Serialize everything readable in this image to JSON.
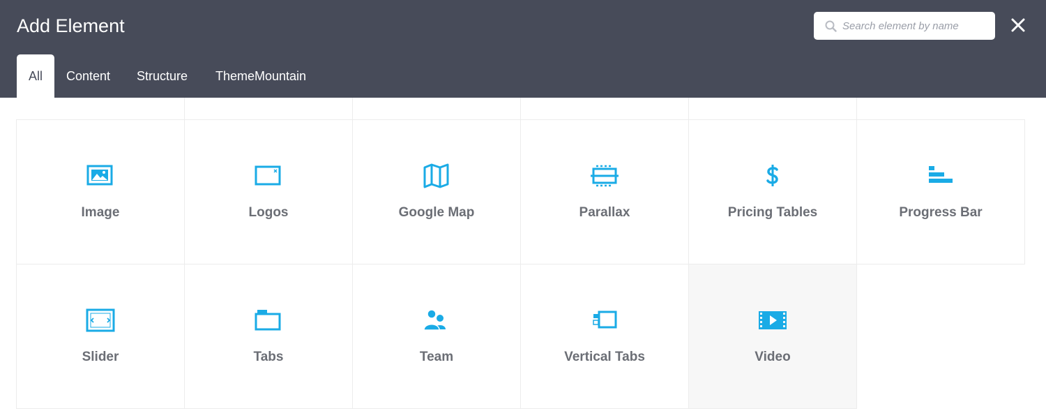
{
  "header": {
    "title": "Add Element",
    "search_placeholder": "Search element by name",
    "search_value": ""
  },
  "tabs": [
    {
      "label": "All",
      "active": true
    },
    {
      "label": "Content",
      "active": false
    },
    {
      "label": "Structure",
      "active": false
    },
    {
      "label": "ThemeMountain",
      "active": false
    }
  ],
  "elements": [
    {
      "label": "Image",
      "icon": "image-icon"
    },
    {
      "label": "Logos",
      "icon": "logos-icon"
    },
    {
      "label": "Google Map",
      "icon": "map-icon"
    },
    {
      "label": "Parallax",
      "icon": "parallax-icon"
    },
    {
      "label": "Pricing Tables",
      "icon": "dollar-icon"
    },
    {
      "label": "Progress Bar",
      "icon": "progress-bar-icon"
    },
    {
      "label": "Slider",
      "icon": "slider-icon"
    },
    {
      "label": "Tabs",
      "icon": "tabs-icon"
    },
    {
      "label": "Team",
      "icon": "team-icon"
    },
    {
      "label": "Vertical Tabs",
      "icon": "vertical-tabs-icon"
    },
    {
      "label": "Video",
      "icon": "video-icon"
    }
  ],
  "colors": {
    "header_bg": "#474b59",
    "accent": "#1aabe6",
    "label": "#6b6e75",
    "border": "#ececec"
  }
}
